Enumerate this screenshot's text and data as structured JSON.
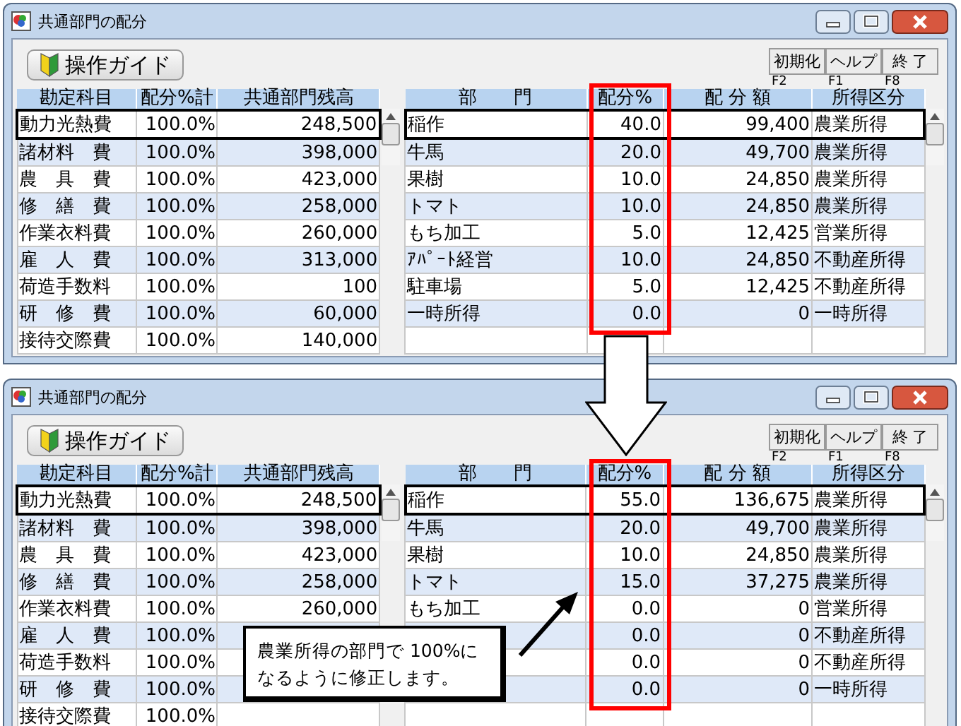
{
  "windows": [
    {
      "title": "共通部門の配分",
      "guide_button": "操作ガイド",
      "tool_buttons": [
        {
          "label": "初期化",
          "key": "F2"
        },
        {
          "label": "ヘルプ",
          "key": "F1"
        },
        {
          "label": "終 了",
          "key": "F8"
        }
      ],
      "accounts": {
        "columns": [
          "勘定科目",
          "配分%計",
          "共通部門残高"
        ],
        "rows": [
          {
            "name": "動力光熱費",
            "percent_total": "100.0%",
            "balance": "248,500",
            "selected": true
          },
          {
            "name": "諸材料　費",
            "percent_total": "100.0%",
            "balance": "398,000",
            "selected": false
          },
          {
            "name": "農　具　費",
            "percent_total": "100.0%",
            "balance": "423,000",
            "selected": false
          },
          {
            "name": "修　繕　費",
            "percent_total": "100.0%",
            "balance": "258,000",
            "selected": false
          },
          {
            "name": "作業衣料費",
            "percent_total": "100.0%",
            "balance": "260,000",
            "selected": false
          },
          {
            "name": "雇　人　費",
            "percent_total": "100.0%",
            "balance": "313,000",
            "selected": false
          },
          {
            "name": "荷造手数料",
            "percent_total": "100.0%",
            "balance": "100",
            "selected": false
          },
          {
            "name": "研　修　費",
            "percent_total": "100.0%",
            "balance": "60,000",
            "selected": false
          },
          {
            "name": "接待交際費",
            "percent_total": "100.0%",
            "balance": "140,000",
            "selected": false
          }
        ]
      },
      "departments": {
        "columns": [
          "部　　門",
          "配分%",
          "配 分 額",
          "所得区分"
        ],
        "rows": [
          {
            "name": "稲作",
            "percent": "40.0",
            "amount": "99,400",
            "income_type": "農業所得",
            "selected": true
          },
          {
            "name": "牛馬",
            "percent": "20.0",
            "amount": "49,700",
            "income_type": "農業所得",
            "selected": false
          },
          {
            "name": "果樹",
            "percent": "10.0",
            "amount": "24,850",
            "income_type": "農業所得",
            "selected": false
          },
          {
            "name": "トマト",
            "percent": "10.0",
            "amount": "24,850",
            "income_type": "農業所得",
            "selected": false
          },
          {
            "name": "もち加工",
            "percent": "5.0",
            "amount": "12,425",
            "income_type": "営業所得",
            "selected": false
          },
          {
            "name": "ｱﾊﾟｰﾄ経営",
            "percent": "10.0",
            "amount": "24,850",
            "income_type": "不動産所得",
            "selected": false
          },
          {
            "name": "駐車場",
            "percent": "5.0",
            "amount": "12,425",
            "income_type": "不動産所得",
            "selected": false
          },
          {
            "name": "一時所得",
            "percent": "0.0",
            "amount": "0",
            "income_type": "一時所得",
            "selected": false
          },
          {
            "selected": false
          }
        ]
      }
    },
    {
      "title": "共通部門の配分",
      "guide_button": "操作ガイド",
      "tool_buttons": [
        {
          "label": "初期化",
          "key": "F2"
        },
        {
          "label": "ヘルプ",
          "key": "F1"
        },
        {
          "label": "終 了",
          "key": "F8"
        }
      ],
      "accounts": {
        "columns": [
          "勘定科目",
          "配分%計",
          "共通部門残高"
        ],
        "rows": [
          {
            "name": "動力光熱費",
            "percent_total": "100.0%",
            "balance": "248,500",
            "selected": true
          },
          {
            "name": "諸材料　費",
            "percent_total": "100.0%",
            "balance": "398,000",
            "selected": false
          },
          {
            "name": "農　具　費",
            "percent_total": "100.0%",
            "balance": "423,000",
            "selected": false
          },
          {
            "name": "修　繕　費",
            "percent_total": "100.0%",
            "balance": "258,000",
            "selected": false
          },
          {
            "name": "作業衣料費",
            "percent_total": "100.0%",
            "balance": "260,000",
            "selected": false
          },
          {
            "name": "雇　人　費",
            "percent_total": "100.0%",
            "selected": false
          },
          {
            "name": "荷造手数料",
            "percent_total": "100.0%",
            "selected": false
          },
          {
            "name": "研　修　費",
            "percent_total": "100.0%",
            "selected": false
          },
          {
            "name": "接待交際費",
            "percent_total": "100.0%",
            "selected": false
          }
        ]
      },
      "departments": {
        "columns": [
          "部　　門",
          "配分%",
          "配 分 額",
          "所得区分"
        ],
        "rows": [
          {
            "name": "稲作",
            "percent": "55.0",
            "amount": "136,675",
            "income_type": "農業所得",
            "selected": true
          },
          {
            "name": "牛馬",
            "percent": "20.0",
            "amount": "49,700",
            "income_type": "農業所得",
            "selected": false
          },
          {
            "name": "果樹",
            "percent": "10.0",
            "amount": "24,850",
            "income_type": "農業所得",
            "selected": false
          },
          {
            "name": "トマト",
            "percent": "15.0",
            "amount": "37,275",
            "income_type": "農業所得",
            "selected": false
          },
          {
            "name": "もち加工",
            "percent": "0.0",
            "amount": "0",
            "income_type": "営業所得",
            "selected": false
          },
          {
            "percent": "0.0",
            "amount": "0",
            "income_type": "不動産所得",
            "selected": false
          },
          {
            "percent": "0.0",
            "amount": "0",
            "income_type": "不動産所得",
            "selected": false
          },
          {
            "percent": "0.0",
            "amount": "0",
            "income_type": "一時所得",
            "selected": false
          },
          {
            "selected": false
          }
        ]
      }
    }
  ],
  "callout": {
    "lines": [
      "農業所得の部門で 100%に",
      "なるように修正します。"
    ]
  }
}
